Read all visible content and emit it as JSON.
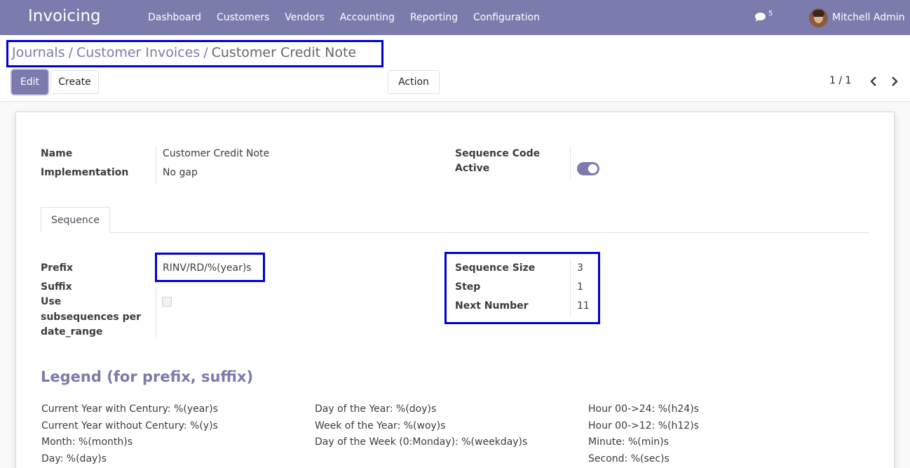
{
  "navbar": {
    "app_name": "Invoicing",
    "menu": [
      "Dashboard",
      "Customers",
      "Vendors",
      "Accounting",
      "Reporting",
      "Configuration"
    ],
    "chat_count": "5",
    "user_name": "Mitchell Admin"
  },
  "breadcrumb": {
    "items": [
      "Journals",
      "Customer Invoices"
    ],
    "separator": "/",
    "current": "Customer Credit Note"
  },
  "toolbar": {
    "edit": "Edit",
    "create": "Create",
    "action": "Action",
    "pager": "1 / 1"
  },
  "form": {
    "name_label": "Name",
    "name_value": "Customer Credit Note",
    "implementation_label": "Implementation",
    "implementation_value": "No gap",
    "sequence_code_label": "Sequence Code",
    "active_label": "Active",
    "active": true
  },
  "tabs": [
    "Sequence"
  ],
  "sequence": {
    "prefix_label": "Prefix",
    "prefix_value": "RINV/RD/%(year)s",
    "suffix_label": "Suffix",
    "use_subseq_label_1": "Use",
    "use_subseq_label_2": "subsequences per",
    "use_subseq_label_3": "date_range",
    "use_subsequences": false,
    "size_label": "Sequence Size",
    "size_value": "3",
    "step_label": "Step",
    "step_value": "1",
    "next_label": "Next Number",
    "next_value": "11"
  },
  "legend": {
    "title": "Legend (for prefix, suffix)",
    "col1": [
      "Current Year with Century: %(year)s",
      "Current Year without Century: %(y)s",
      "Month: %(month)s",
      "Day: %(day)s"
    ],
    "col2": [
      "Day of the Year: %(doy)s",
      "Week of the Year: %(woy)s",
      "Day of the Week (0:Monday): %(weekday)s"
    ],
    "col3": [
      "Hour 00->24: %(h24)s",
      "Hour 00->12: %(h12)s",
      "Minute: %(min)s",
      "Second: %(sec)s"
    ]
  },
  "colors": {
    "brand": "#7c7bad",
    "highlight_box": "#0000d6"
  }
}
